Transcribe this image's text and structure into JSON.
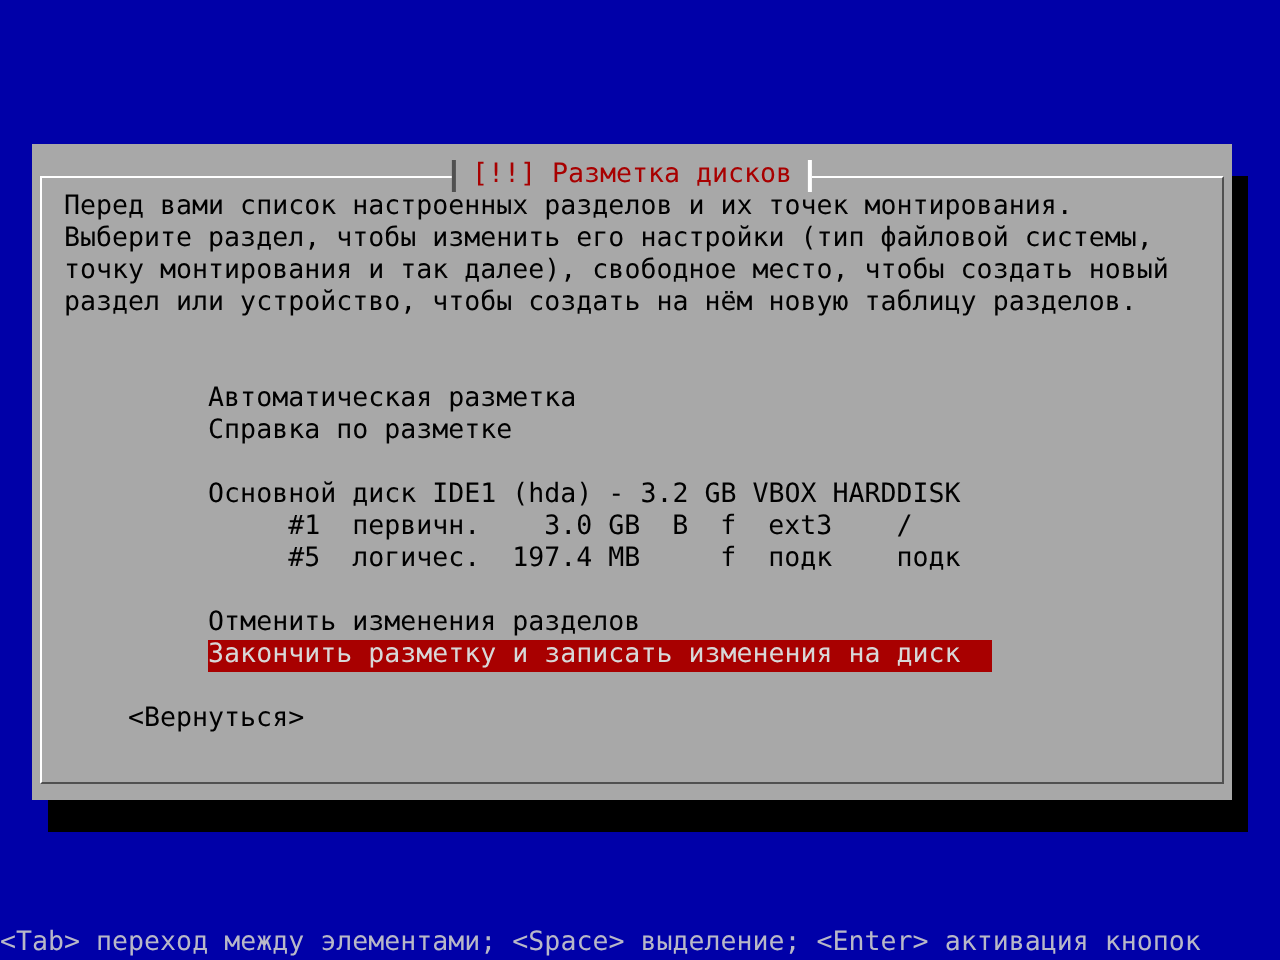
{
  "dialog": {
    "title": "[!!] Разметка дисков",
    "description": "Перед вами список настроенных разделов и их точек монтирования. Выберите раздел, чтобы изменить его настройки (тип файловой системы, точку монтирования и так далее), свободное место, чтобы создать новый раздел или устройство, чтобы создать на нём новую таблицу разделов.",
    "menu_groups": [
      [
        {
          "kind": "action",
          "label": "Автоматическая разметка",
          "selected": false
        },
        {
          "kind": "action",
          "label": "Справка по разметке",
          "selected": false
        }
      ],
      [
        {
          "kind": "disk",
          "label": "Основной диск IDE1 (hda) - 3.2 GB VBOX HARDDISK",
          "selected": false,
          "children": [
            {
              "kind": "partition",
              "number": "#1",
              "type": "первичн.",
              "size": "3.0 GB",
              "boot": "B",
              "flag": "f",
              "filesystem": "ext3",
              "mount": "/",
              "selected": false
            },
            {
              "kind": "partition",
              "number": "#5",
              "type": "логичес.",
              "size": "197.4 MB",
              "flag": "f",
              "filesystem": "подк",
              "mount": "подк",
              "selected": false
            }
          ]
        }
      ],
      [
        {
          "kind": "action",
          "label": "Отменить изменения разделов",
          "selected": false
        },
        {
          "kind": "action",
          "label": "Закончить разметку и записать изменения на диск",
          "selected": true
        }
      ]
    ],
    "buttons": [
      {
        "label": "<Вернуться>",
        "selected": false
      }
    ]
  },
  "status_bar": "<Tab> переход между элементами; <Space> выделение; <Enter> активация кнопок"
}
